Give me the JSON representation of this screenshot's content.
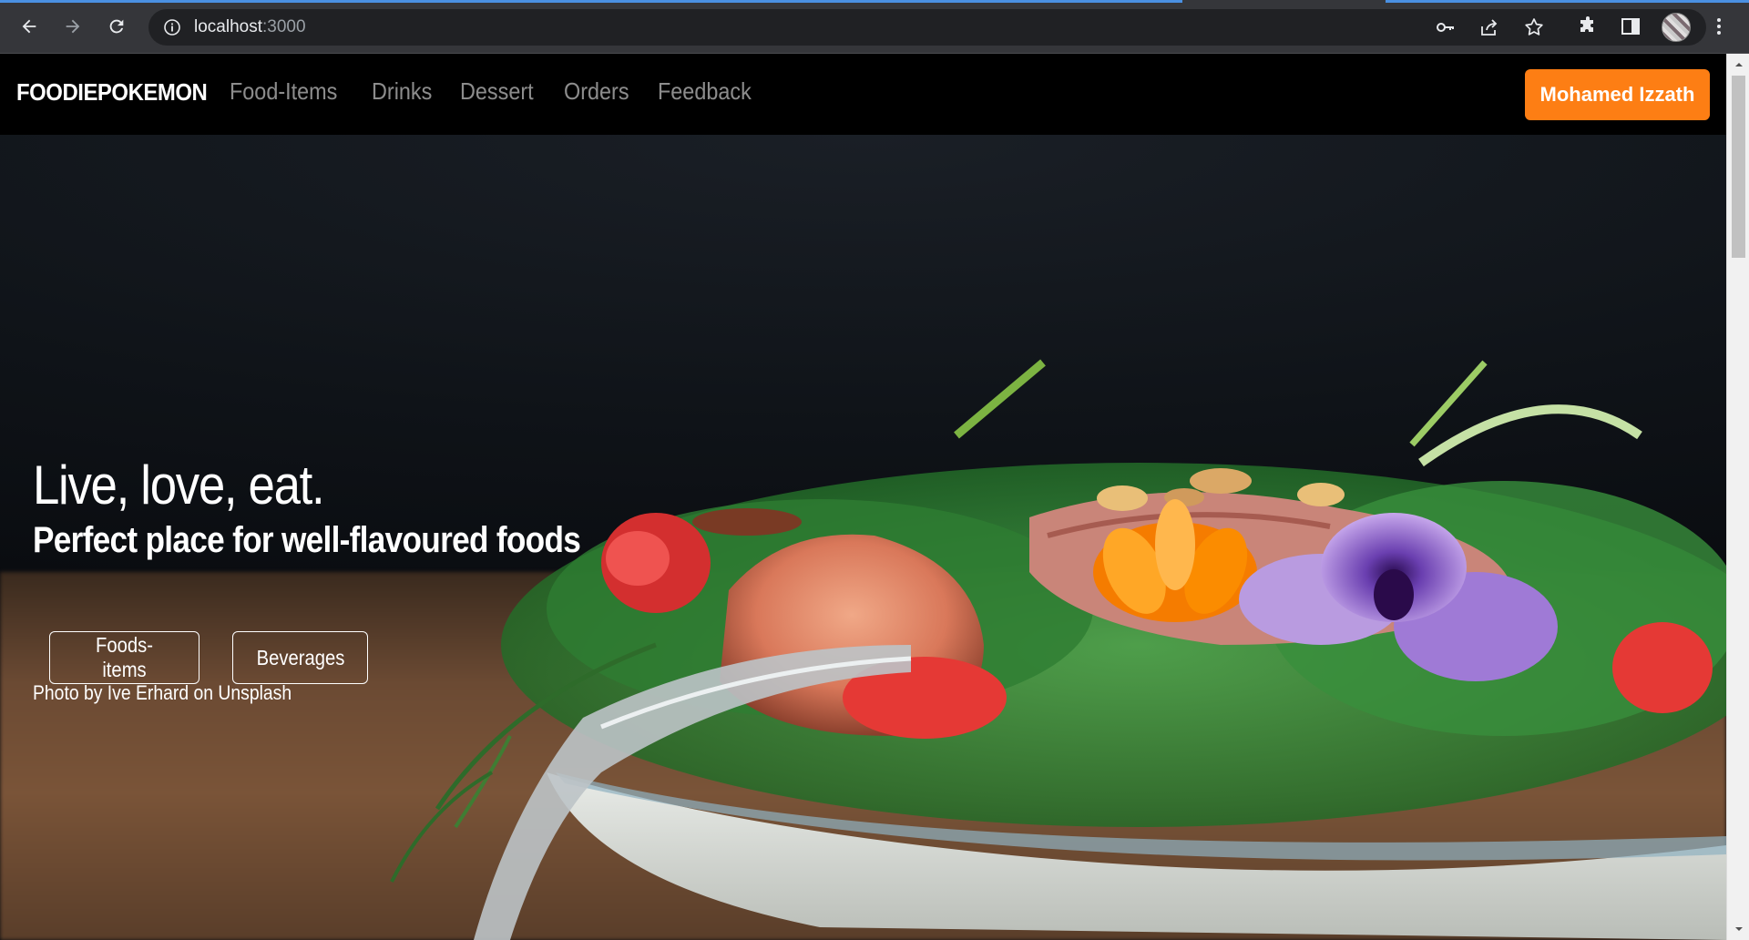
{
  "browser": {
    "url_host": "localhost",
    "url_port": ":3000",
    "icons": {
      "back": "arrow-left-icon",
      "forward": "arrow-right-icon",
      "reload": "reload-icon",
      "site_info": "info-icon",
      "password": "key-icon",
      "share": "share-icon",
      "bookmark": "star-icon",
      "extensions": "puzzle-icon",
      "side_panel": "side-panel-icon",
      "menu": "kebab-menu-icon"
    }
  },
  "navbar": {
    "brand": "FOODIEPOKEMON",
    "links": [
      {
        "label": "Food-Items"
      },
      {
        "label": "Drinks"
      },
      {
        "label": "Dessert"
      },
      {
        "label": "Orders"
      },
      {
        "label": "Feedback"
      }
    ],
    "user_button": "Mohamed Izzath",
    "colors": {
      "background": "#000000",
      "link": "rgba(255,255,255,0.55)",
      "user_button_bg": "#fd7e14"
    }
  },
  "hero": {
    "title": "Live, love, eat.",
    "subtitle": "Perfect place for well-flavoured foods",
    "buttons": [
      {
        "label": "Foods-items"
      },
      {
        "label": "Beverages"
      }
    ],
    "photo_credit": "Photo by Ive Erhard on Unsplash"
  }
}
